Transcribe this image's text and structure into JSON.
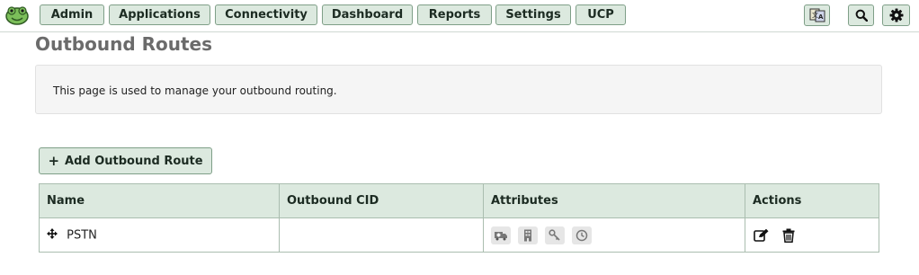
{
  "nav": {
    "items": [
      {
        "label": "Admin"
      },
      {
        "label": "Applications"
      },
      {
        "label": "Connectivity"
      },
      {
        "label": "Dashboard"
      },
      {
        "label": "Reports"
      },
      {
        "label": "Settings"
      },
      {
        "label": "UCP"
      }
    ],
    "icons": [
      "translate-icon",
      "search-icon",
      "gear-icon"
    ]
  },
  "page": {
    "title": "Outbound Routes",
    "info": "This page is used to manage your outbound routing."
  },
  "add_button": {
    "label": "Add Outbound Route"
  },
  "table": {
    "columns": [
      "Name",
      "Outbound CID",
      "Attributes",
      "Actions"
    ],
    "rows": [
      {
        "name": "PSTN",
        "outbound_cid": ""
      }
    ]
  },
  "colors": {
    "accent_bg": "#dce9df",
    "accent_border": "#7f9f88"
  }
}
